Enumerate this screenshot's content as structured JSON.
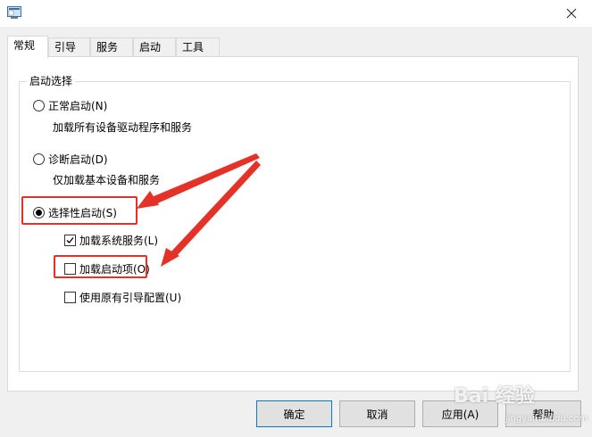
{
  "tabs": [
    "常规",
    "引导",
    "服务",
    "启动",
    "工具"
  ],
  "active_tab": "常规",
  "startup_group": {
    "legend": "启动选择",
    "normal": {
      "label": "正常启动(N)",
      "desc": "加载所有设备驱动程序和服务",
      "checked": false
    },
    "diagnostic": {
      "label": "诊断启动(D)",
      "desc": "仅加载基本设备和服务",
      "checked": false
    },
    "selective": {
      "label": "选择性启动(S)",
      "checked": true
    },
    "options": [
      {
        "label": "加载系统服务(L)",
        "checked": true
      },
      {
        "label": "加载启动项(O)",
        "checked": false
      },
      {
        "label": "使用原有引导配置(U)",
        "checked": false
      }
    ]
  },
  "buttons": {
    "ok": "确定",
    "cancel": "取消",
    "apply": "应用(A)",
    "help": "帮助"
  },
  "watermark": {
    "main": "Bai 经验",
    "sub": "jingyan.baidu.com"
  },
  "colors": {
    "annotation_red": "#e53228",
    "accent_blue": "#0078d7"
  }
}
